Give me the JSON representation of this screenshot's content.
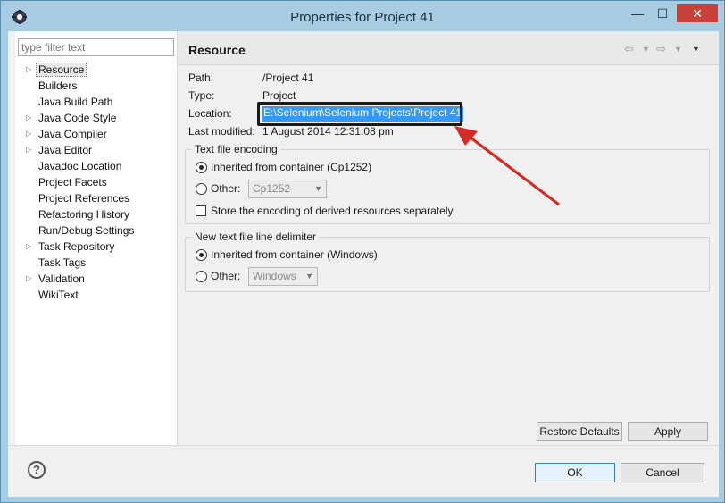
{
  "window": {
    "title": "Properties for Project 41",
    "minimize": "—",
    "maximize": "☐",
    "close": "✕"
  },
  "sidebar": {
    "filter_placeholder": "type filter text",
    "items": [
      {
        "label": "Resource",
        "expandable": true,
        "selected": true
      },
      {
        "label": "Builders",
        "expandable": false
      },
      {
        "label": "Java Build Path",
        "expandable": false
      },
      {
        "label": "Java Code Style",
        "expandable": true
      },
      {
        "label": "Java Compiler",
        "expandable": true
      },
      {
        "label": "Java Editor",
        "expandable": true
      },
      {
        "label": "Javadoc Location",
        "expandable": false
      },
      {
        "label": "Project Facets",
        "expandable": false
      },
      {
        "label": "Project References",
        "expandable": false
      },
      {
        "label": "Refactoring History",
        "expandable": false
      },
      {
        "label": "Run/Debug Settings",
        "expandable": false
      },
      {
        "label": "Task Repository",
        "expandable": true
      },
      {
        "label": "Task Tags",
        "expandable": false
      },
      {
        "label": "Validation",
        "expandable": true
      },
      {
        "label": "WikiText",
        "expandable": false
      }
    ]
  },
  "page": {
    "title": "Resource",
    "nav": {
      "back_icon": "back-arrow-icon",
      "forward_icon": "forward-arrow-icon",
      "menu_icon": "view-menu-icon"
    },
    "fields": {
      "path_label": "Path:",
      "path_value": "/Project 41",
      "type_label": "Type:",
      "type_value": "Project",
      "location_label": "Location:",
      "location_value": "E:\\Selenium\\Selenium Projects\\Project 41",
      "modified_label": "Last modified:",
      "modified_value": "1 August 2014 12:31:08 pm"
    },
    "encoding": {
      "group_title": "Text file encoding",
      "inherited_label": "Inherited from container (Cp1252)",
      "inherited_selected": true,
      "other_label": "Other:",
      "other_value": "Cp1252",
      "store_label": "Store the encoding of derived resources separately",
      "store_checked": false
    },
    "delimiter": {
      "group_title": "New text file line delimiter",
      "inherited_label": "Inherited from container (Windows)",
      "inherited_selected": true,
      "other_label": "Other:",
      "other_value": "Windows"
    },
    "buttons": {
      "restore_defaults": "Restore Defaults",
      "apply": "Apply"
    }
  },
  "footer": {
    "help": "?",
    "ok": "OK",
    "cancel": "Cancel"
  },
  "colors": {
    "title_bar": "#a8cde3",
    "selection": "#3399ff",
    "annotation_arrow": "#d42a23",
    "close_button": "#c7403a"
  }
}
